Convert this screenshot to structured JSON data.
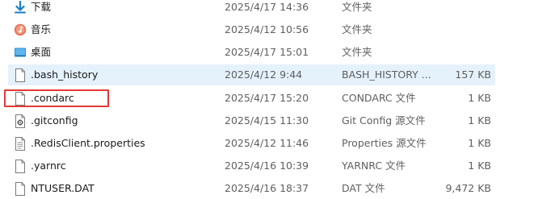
{
  "highlight_color": "#e53935",
  "selected_row_color": "#e5f1fb",
  "rows": [
    {
      "icon": "download-folder-icon",
      "name": "下载",
      "date": "2025/4/17 14:36",
      "type": "文件夹",
      "size": ""
    },
    {
      "icon": "music-folder-icon",
      "name": "音乐",
      "date": "2025/4/12 10:56",
      "type": "文件夹",
      "size": ""
    },
    {
      "icon": "desktop-folder-icon",
      "name": "桌面",
      "date": "2025/4/17 15:01",
      "type": "文件夹",
      "size": ""
    },
    {
      "icon": "file-icon",
      "name": ".bash_history",
      "date": "2025/4/12 9:44",
      "type": "BASH_HISTORY ...",
      "size": "157 KB",
      "selected": true
    },
    {
      "icon": "file-icon",
      "name": ".condarc",
      "date": "2025/4/17 15:20",
      "type": "CONDARC 文件",
      "size": "1 KB",
      "highlighted": true
    },
    {
      "icon": "gear-file-icon",
      "name": ".gitconfig",
      "date": "2025/4/15 11:30",
      "type": "Git Config 源文件",
      "size": "1 KB"
    },
    {
      "icon": "text-file-icon",
      "name": ".RedisClient.properties",
      "date": "2025/4/12 11:46",
      "type": "Properties 源文件",
      "size": "1 KB"
    },
    {
      "icon": "file-icon",
      "name": ".yarnrc",
      "date": "2025/4/16 10:39",
      "type": "YARNRC 文件",
      "size": "1 KB"
    },
    {
      "icon": "file-icon",
      "name": "NTUSER.DAT",
      "date": "2025/4/16 18:37",
      "type": "DAT 文件",
      "size": "9,472 KB"
    }
  ]
}
